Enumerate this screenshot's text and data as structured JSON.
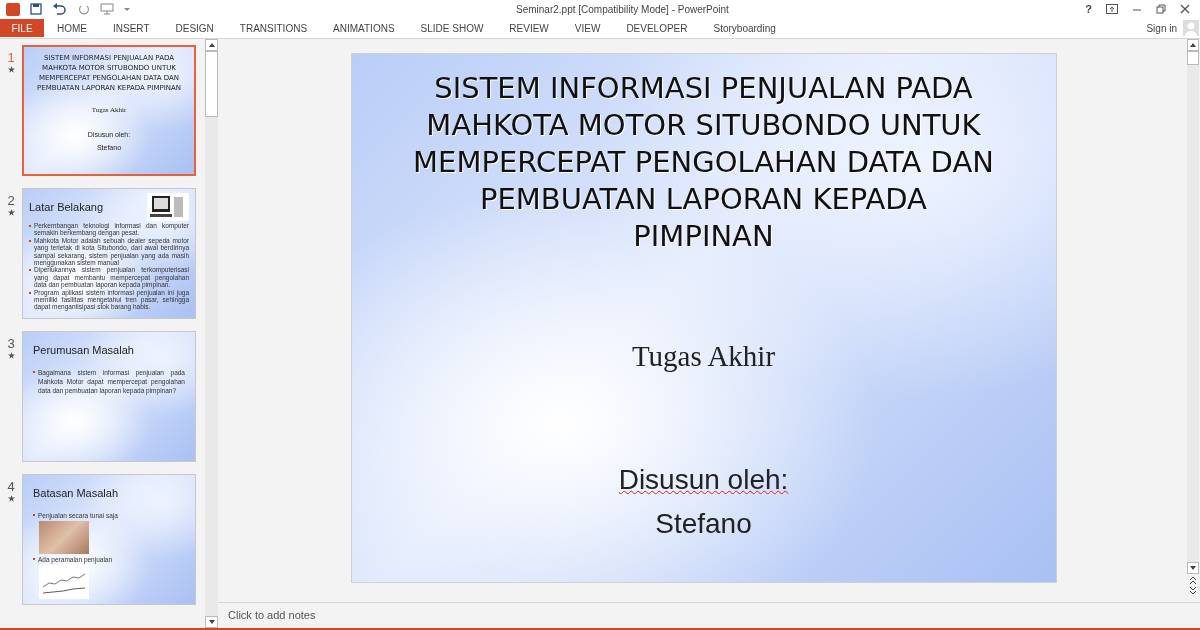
{
  "window": {
    "title": "Seminar2.ppt [Compatibility Mode] - PowerPoint",
    "help": "?"
  },
  "ribbon_tabs": [
    {
      "label": "FILE",
      "kind": "file"
    },
    {
      "label": "HOME",
      "kind": "tab"
    },
    {
      "label": "INSERT",
      "kind": "tab"
    },
    {
      "label": "DESIGN",
      "kind": "tab"
    },
    {
      "label": "TRANSITIONS",
      "kind": "tab"
    },
    {
      "label": "ANIMATIONS",
      "kind": "tab"
    },
    {
      "label": "SLIDE SHOW",
      "kind": "tab"
    },
    {
      "label": "REVIEW",
      "kind": "tab"
    },
    {
      "label": "VIEW",
      "kind": "tab"
    },
    {
      "label": "DEVELOPER",
      "kind": "tab"
    },
    {
      "label": "Storyboarding",
      "kind": "tab"
    }
  ],
  "account": {
    "label": "Sign in"
  },
  "slides": [
    {
      "number": "1",
      "selected": true,
      "kind": "title",
      "title": "SISTEM INFORMASI PENJUALAN PADA MAHKOTA MOTOR SITUBONDO UNTUK MEMPERCEPAT PENGOLAHAN DATA DAN PEMBUATAN LAPORAN KEPADA PIMPINAN",
      "lines": [
        "Tugas Akhir",
        "Disusun oleh:",
        "Stefano"
      ]
    },
    {
      "number": "2",
      "selected": false,
      "kind": "content",
      "title": "Latar Belakang",
      "picture": true,
      "items": [
        {
          "kind": "bullet",
          "text": "Perkembangan teknologi informasi dan komputer semakin berkembang dengan pesat."
        },
        {
          "kind": "bullet",
          "text": "Mahkota Motor adalah sebuah dealer sepeda motor yang terletak di kota Situbondo, dari awal berdirinya sampai sekarang, sistem penjualan yang ada masih menggunakan sistem manual"
        },
        {
          "kind": "bullet",
          "text": "Diperlukannya sistem penjualan terkomputerisasi yang dapat membantu mempercepat pengolahan data dan pembuatan laporan kepada pimpinan."
        },
        {
          "kind": "bullet",
          "text": "Program aplikasi sistem informasi penjualan ini juga memiliki fasilitas mengetahui tren pasar, sehingga dapat mengantisipasi stok barang habis."
        }
      ]
    },
    {
      "number": "3",
      "selected": false,
      "kind": "content",
      "title": "Perumusan Masalah",
      "items": [
        {
          "kind": "bullet",
          "text": "Bagaimana sistem informasi penjualan pada Mahkota Motor dapat mempercepat pengolahan data dan pembuatan laporan kepada pimpinan?"
        }
      ]
    },
    {
      "number": "4",
      "selected": false,
      "kind": "content",
      "title": "Batasan Masalah",
      "items": [
        {
          "kind": "bullet",
          "text": "Penjualan secara tunai saja"
        },
        {
          "kind": "photo"
        },
        {
          "kind": "bullet",
          "text": "Ada peramalan penjualan"
        },
        {
          "kind": "graph"
        }
      ]
    }
  ],
  "main_slide": {
    "title": "SISTEM INFORMASI PENJUALAN PADA MAHKOTA MOTOR SITUBONDO UNTUK MEMPERCEPAT PENGOLAHAN DATA DAN PEMBUATAN LAPORAN KEPADA PIMPINAN",
    "subtitle": "Tugas Akhir",
    "author_label": {
      "text": "Disusun oleh:",
      "misspelled": true
    },
    "author": "Stefano"
  },
  "notes": {
    "placeholder": "Click to add notes"
  }
}
